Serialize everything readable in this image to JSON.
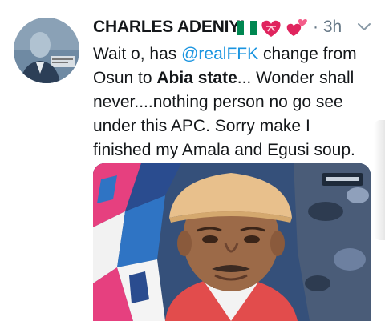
{
  "tweet": {
    "author_name": "CHARLES ADENIYI",
    "emoji": [
      "flag-nigeria",
      "heart-ribbon",
      "two-hearts"
    ],
    "separator": "·",
    "time": "3h",
    "text": {
      "part1": "Wait o, has ",
      "mention": "@realFFK",
      "part2": " change from",
      "line2a": "Osun to ",
      "line2b": "Abia state",
      "line2c": "... Wonder shall",
      "line3": "never....nothing person no go see",
      "line4": "under this APC. Sorry make I",
      "line5": "finished my Amala and Egusi soup."
    },
    "media_alt": "photo",
    "icons": {
      "menu": "chevron-down-icon"
    },
    "colors": {
      "name": "#14171a",
      "secondary": "#657786",
      "link": "#1b95e0",
      "flag_green": "#008751",
      "heart": "#e0245e"
    }
  }
}
